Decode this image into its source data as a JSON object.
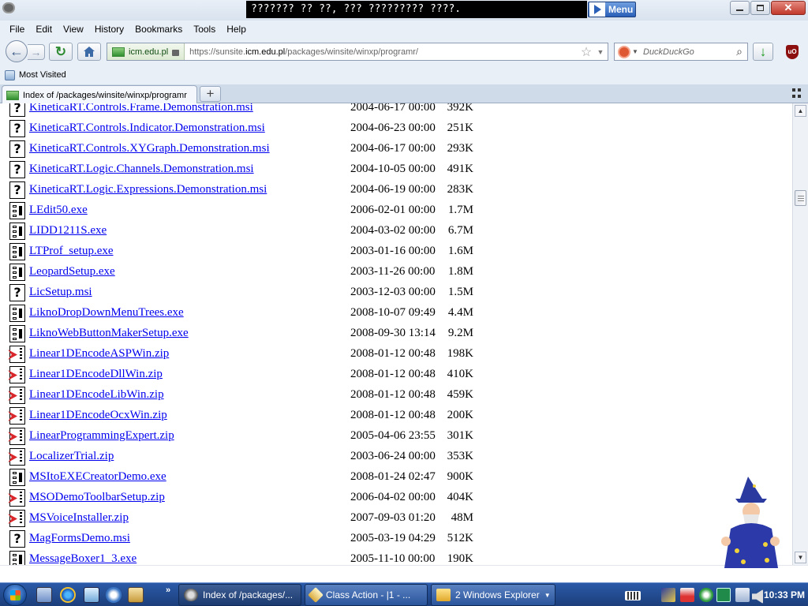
{
  "window": {
    "title": "??????? ?? ??, ??? ????????? ????.",
    "menu_button": "Menu"
  },
  "menubar": {
    "items": [
      "File",
      "Edit",
      "View",
      "History",
      "Bookmarks",
      "Tools",
      "Help"
    ]
  },
  "navbar": {
    "identity": "icm.edu.pl",
    "url_prefix": "https://sunsite.",
    "url_host": "icm.edu.pl",
    "url_path": "/packages/winsite/winxp/programr/",
    "search_placeholder": "DuckDuckGo"
  },
  "bookmarks": {
    "most_visited": "Most Visited"
  },
  "tabs": [
    {
      "label": "Index of /packages/winsite/winxp/programr"
    }
  ],
  "listing": {
    "rows": [
      {
        "name": "KineticaRT.Controls.Frame.Demonstration.msi",
        "date": "2004-06-17 00:00",
        "size": "392K",
        "icon": "unknown-file-icon"
      },
      {
        "name": "KineticaRT.Controls.Indicator.Demonstration.msi",
        "date": "2004-06-23 00:00",
        "size": "251K",
        "icon": "unknown-file-icon"
      },
      {
        "name": "KineticaRT.Controls.XYGraph.Demonstration.msi",
        "date": "2004-06-17 00:00",
        "size": "293K",
        "icon": "unknown-file-icon"
      },
      {
        "name": "KineticaRT.Logic.Channels.Demonstration.msi",
        "date": "2004-10-05 00:00",
        "size": "491K",
        "icon": "unknown-file-icon"
      },
      {
        "name": "KineticaRT.Logic.Expressions.Demonstration.msi",
        "date": "2004-06-19 00:00",
        "size": "283K",
        "icon": "unknown-file-icon"
      },
      {
        "name": "LEdit50.exe",
        "date": "2006-02-01 00:00",
        "size": "1.7M",
        "icon": "binary-file-icon"
      },
      {
        "name": "LIDD1211S.exe",
        "date": "2004-03-02 00:00",
        "size": "6.7M",
        "icon": "binary-file-icon"
      },
      {
        "name": "LTProf_setup.exe",
        "date": "2003-01-16 00:00",
        "size": "1.6M",
        "icon": "binary-file-icon"
      },
      {
        "name": "LeopardSetup.exe",
        "date": "2003-11-26 00:00",
        "size": "1.8M",
        "icon": "binary-file-icon"
      },
      {
        "name": "LicSetup.msi",
        "date": "2003-12-03 00:00",
        "size": "1.5M",
        "icon": "unknown-file-icon"
      },
      {
        "name": "LiknoDropDownMenuTrees.exe",
        "date": "2008-10-07 09:49",
        "size": "4.4M",
        "icon": "binary-file-icon"
      },
      {
        "name": "LiknoWebButtonMakerSetup.exe",
        "date": "2008-09-30 13:14",
        "size": "9.2M",
        "icon": "binary-file-icon"
      },
      {
        "name": "Linear1DEncodeASPWin.zip",
        "date": "2008-01-12 00:48",
        "size": "198K",
        "icon": "zip-file-icon"
      },
      {
        "name": "Linear1DEncodeDllWin.zip",
        "date": "2008-01-12 00:48",
        "size": "410K",
        "icon": "zip-file-icon"
      },
      {
        "name": "Linear1DEncodeLibWin.zip",
        "date": "2008-01-12 00:48",
        "size": "459K",
        "icon": "zip-file-icon"
      },
      {
        "name": "Linear1DEncodeOcxWin.zip",
        "date": "2008-01-12 00:48",
        "size": "200K",
        "icon": "zip-file-icon"
      },
      {
        "name": "LinearProgrammingExpert.zip",
        "date": "2005-04-06 23:55",
        "size": "301K",
        "icon": "zip-file-icon"
      },
      {
        "name": "LocalizerTrial.zip",
        "date": "2003-06-24 00:00",
        "size": "353K",
        "icon": "zip-file-icon"
      },
      {
        "name": "MSItoEXECreatorDemo.exe",
        "date": "2008-01-24 02:47",
        "size": "900K",
        "icon": "binary-file-icon"
      },
      {
        "name": "MSODemoToolbarSetup.zip",
        "date": "2006-04-02 00:00",
        "size": "404K",
        "icon": "zip-file-icon"
      },
      {
        "name": "MSVoiceInstaller.zip",
        "date": "2007-09-03 01:20",
        "size": "48M",
        "icon": "zip-file-icon"
      },
      {
        "name": "MagFormsDemo.msi",
        "date": "2005-03-19 04:29",
        "size": "512K",
        "icon": "unknown-file-icon"
      },
      {
        "name": "MessageBoxer1_3.exe",
        "date": "2005-11-10 00:00",
        "size": "190K",
        "icon": "binary-file-icon"
      }
    ]
  },
  "taskbar": {
    "tasks": [
      {
        "label": "Index of /packages/..."
      },
      {
        "label": "Class Action - |1 - ..."
      },
      {
        "label": "2 Windows Explorer"
      }
    ],
    "clock": "10:33 PM"
  }
}
